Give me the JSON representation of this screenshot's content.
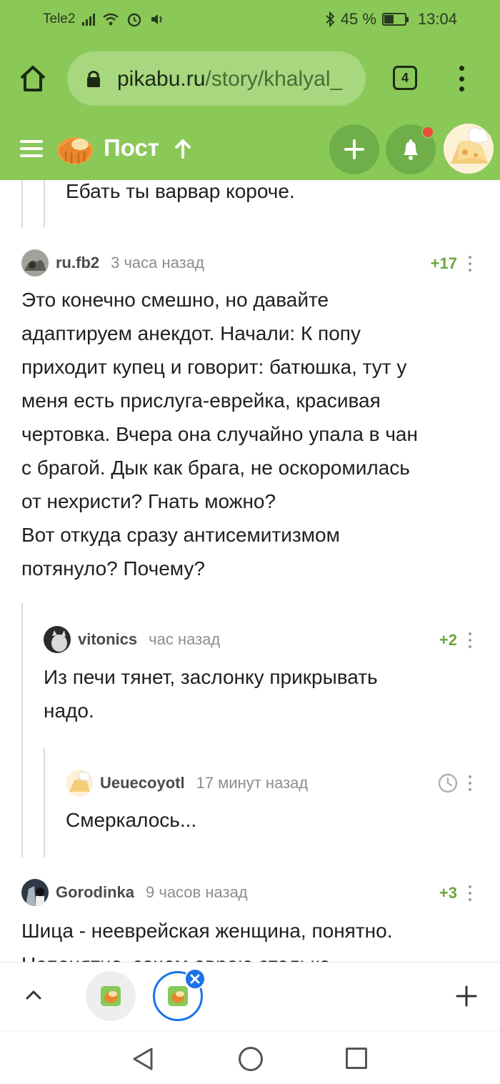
{
  "status_bar": {
    "carrier": "Tele2",
    "battery": "45 %",
    "time": "13:04"
  },
  "browser": {
    "url_host": "pikabu.ru",
    "url_path": "/story/khalyal_",
    "tab_count": "4"
  },
  "header": {
    "title": "Пост"
  },
  "comments": [
    {
      "text": "Ебать ты варвар короче."
    },
    {
      "user": "ru.fb2",
      "time": "3 часа назад",
      "rating": "+17",
      "text": "Это конечно смешно, но давайте\nадаптируем анекдот. Начали: К попу\nприходит купец и говорит: батюшка, тут у\nменя есть прислуга-еврейка, красивая\nчертовка. Вчера она случайно упала в чан\nс брагой. Дык как брага, не оскоромилась\nот нехристи? Гнать можно?\nВот откуда сразу антисемитизмом\nпотянуло? Почему?"
    },
    {
      "user": "vitonics",
      "time": "час назад",
      "rating": "+2",
      "text": "Из печи тянет, заслонку прикрывать\nнадо."
    },
    {
      "user": "Ueuecoyotl",
      "time": "17 минут назад",
      "text": "Смеркалось..."
    },
    {
      "user": "Gorodinka",
      "time": "9 часов назад",
      "rating": "+3",
      "text": "Шица - нееврейская женщина, понятно.\nНепонятно, зачем еврею столько"
    }
  ],
  "colors": {
    "pikabu_green": "#8ac858",
    "rating_green": "#6aa53e",
    "tab_blue": "#1a73e8"
  },
  "icons": {
    "home": "home-icon",
    "lock": "lock-icon",
    "menu": "more-vertical-icon",
    "add": "plus-icon",
    "bell": "bell-icon",
    "clock": "clock-icon"
  }
}
